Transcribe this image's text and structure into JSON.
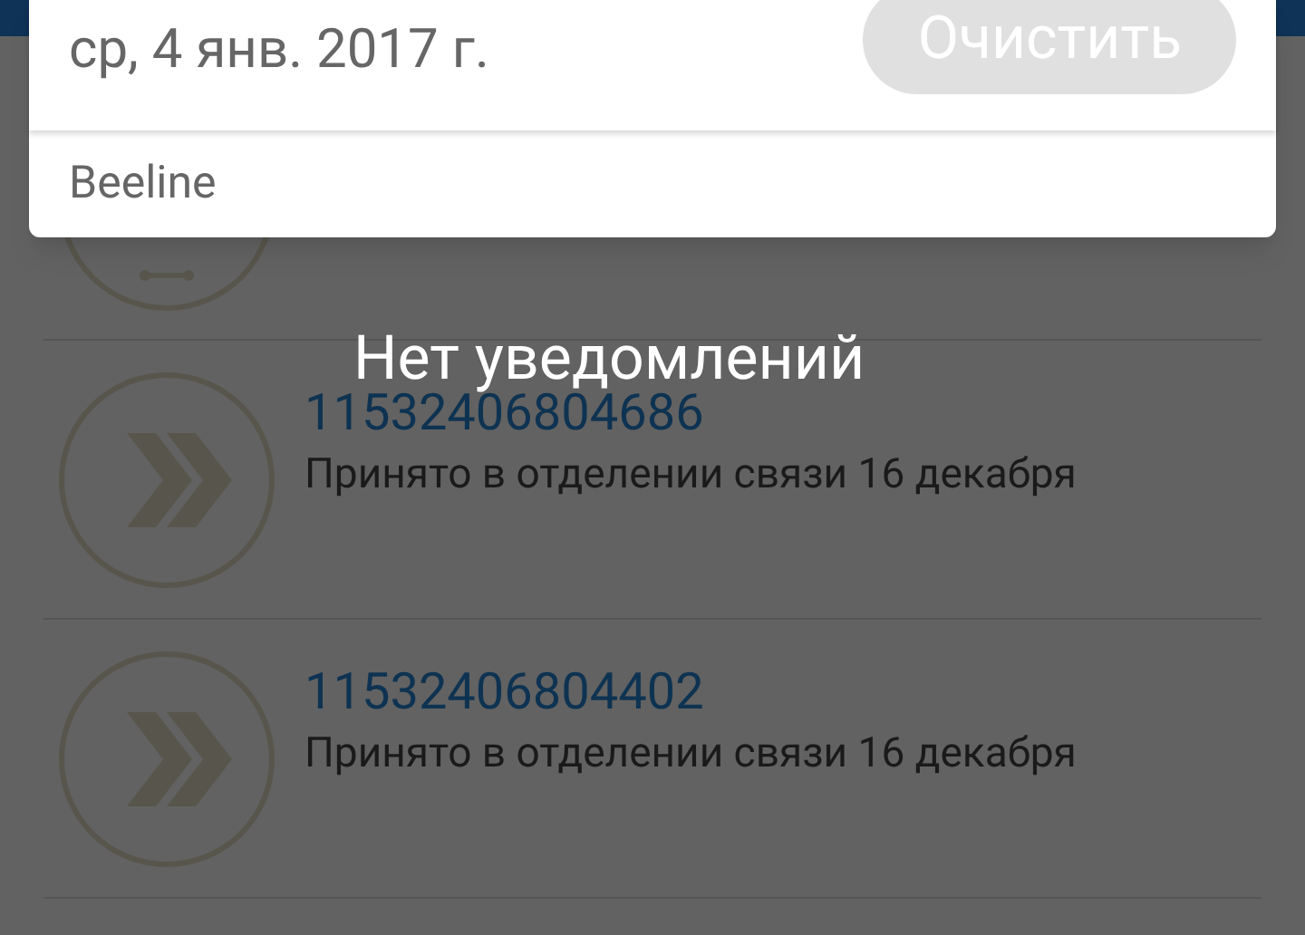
{
  "notification_shade": {
    "date": "ср, 4 янв. 2017 г.",
    "clear_button": {
      "label": "Очистить",
      "disabled": true
    },
    "notifications": [
      {
        "app": "Beeline"
      }
    ],
    "empty_message": "Нет уведомлений"
  },
  "parcels": [
    {
      "number": "11532406804686",
      "status": "Принято в отделении связи 16 декабря"
    },
    {
      "number": "11532406804402",
      "status": "Принято в отделении связи 16 декабря"
    }
  ]
}
